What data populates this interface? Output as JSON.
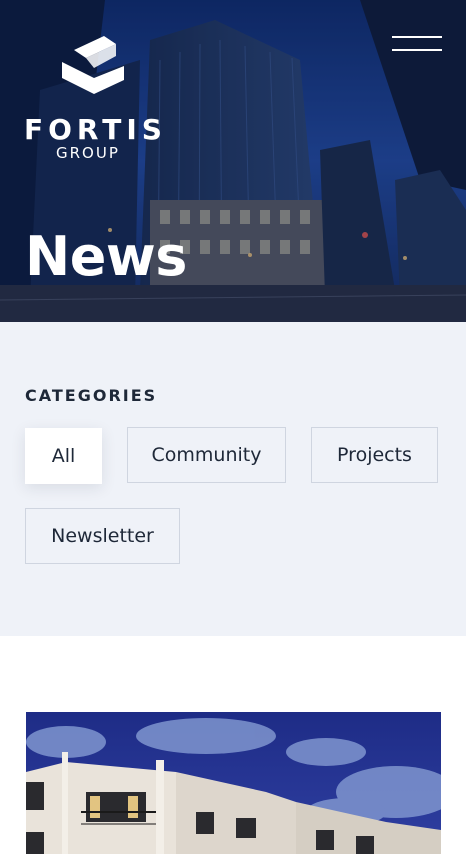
{
  "brand": {
    "name": "FORTIS",
    "sub": "GROUP"
  },
  "hero": {
    "title": "News"
  },
  "categories": {
    "heading": "CATEGORIES",
    "items": [
      {
        "label": "All",
        "active": true
      },
      {
        "label": "Community",
        "active": false
      },
      {
        "label": "Projects",
        "active": false
      },
      {
        "label": "Newsletter",
        "active": false
      }
    ]
  },
  "icons": {
    "menu": "hamburger-menu-icon",
    "logo": "fortis-logo-mark"
  },
  "colors": {
    "hero_overlay": "#17336f",
    "categories_bg": "#eff2f8",
    "text_dark": "#1e2838",
    "chip_border": "#cfd5e0"
  }
}
